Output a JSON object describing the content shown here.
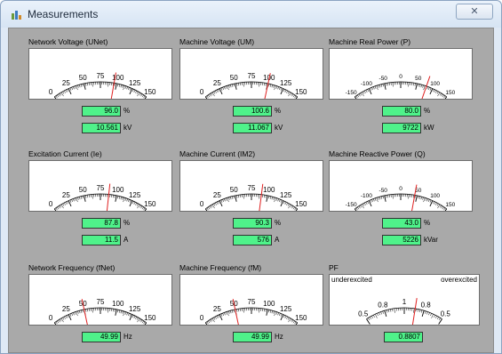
{
  "window": {
    "title": "Measurements",
    "close_glyph": "✕",
    "icon": "measurements-app-icon"
  },
  "panels": [
    {
      "title": "Network Voltage (UNet)",
      "scale": [
        "0",
        "25",
        "50",
        "75",
        "100",
        "125",
        "150"
      ],
      "range": [
        0,
        150
      ],
      "needle": 96.0,
      "rows": [
        {
          "value": "96.0",
          "unit": "%"
        },
        {
          "value": "10.561",
          "unit": "kV"
        }
      ]
    },
    {
      "title": "Machine Voltage (UM)",
      "scale": [
        "0",
        "25",
        "50",
        "75",
        "100",
        "125",
        "150"
      ],
      "range": [
        0,
        150
      ],
      "needle": 100.6,
      "rows": [
        {
          "value": "100.6",
          "unit": "%"
        },
        {
          "value": "11.067",
          "unit": "kV"
        }
      ]
    },
    {
      "title": "Machine Real Power (P)",
      "scale": [
        "-150",
        "-100",
        "-50",
        "0",
        "50",
        "100",
        "150"
      ],
      "range": [
        -150,
        150
      ],
      "needle": 80.0,
      "rows": [
        {
          "value": "80.0",
          "unit": "%"
        },
        {
          "value": "9722",
          "unit": "kW"
        }
      ]
    },
    {
      "title": "Excitation Current (Ie)",
      "scale": [
        "0",
        "25",
        "50",
        "75",
        "100",
        "125",
        "150"
      ],
      "range": [
        0,
        150
      ],
      "needle": 87.8,
      "rows": [
        {
          "value": "87.8",
          "unit": "%"
        },
        {
          "value": "11.5",
          "unit": "A"
        }
      ]
    },
    {
      "title": "Machine Current (IM2)",
      "scale": [
        "0",
        "25",
        "50",
        "75",
        "100",
        "125",
        "150"
      ],
      "range": [
        0,
        150
      ],
      "needle": 90.3,
      "rows": [
        {
          "value": "90.3",
          "unit": "%"
        },
        {
          "value": "576",
          "unit": "A"
        }
      ]
    },
    {
      "title": "Machine Reactive Power (Q)",
      "scale": [
        "-150",
        "-100",
        "-50",
        "0",
        "50",
        "100",
        "150"
      ],
      "range": [
        -150,
        150
      ],
      "needle": 43.0,
      "rows": [
        {
          "value": "43.0",
          "unit": "%"
        },
        {
          "value": "5226",
          "unit": "kVar"
        }
      ]
    },
    {
      "title": "Network Frequency (fNet)",
      "scale": [
        "0",
        "25",
        "50",
        "75",
        "100",
        "125",
        "150"
      ],
      "range": [
        0,
        150
      ],
      "needle": 49.99,
      "rows": [
        {
          "value": "49.99",
          "unit": "Hz"
        }
      ]
    },
    {
      "title": "Machine Frequency (fM)",
      "scale": [
        "0",
        "25",
        "50",
        "75",
        "100",
        "125",
        "150"
      ],
      "range": [
        0,
        150
      ],
      "needle": 49.99,
      "rows": [
        {
          "value": "49.99",
          "unit": "Hz"
        }
      ]
    },
    {
      "title": "PF",
      "scale": [
        "0.5",
        "0.8",
        "1",
        "0.8",
        "0.5"
      ],
      "range": [
        0,
        4
      ],
      "needle": 2.55,
      "pf": true,
      "underexcited": "underexcited",
      "overexcited": "overexcited",
      "rows": [
        {
          "value": "0.8807",
          "unit": ""
        }
      ]
    }
  ],
  "colors": {
    "needle": "#e02020",
    "value_box": "#4ff28a",
    "background": "#a9a9a9"
  }
}
